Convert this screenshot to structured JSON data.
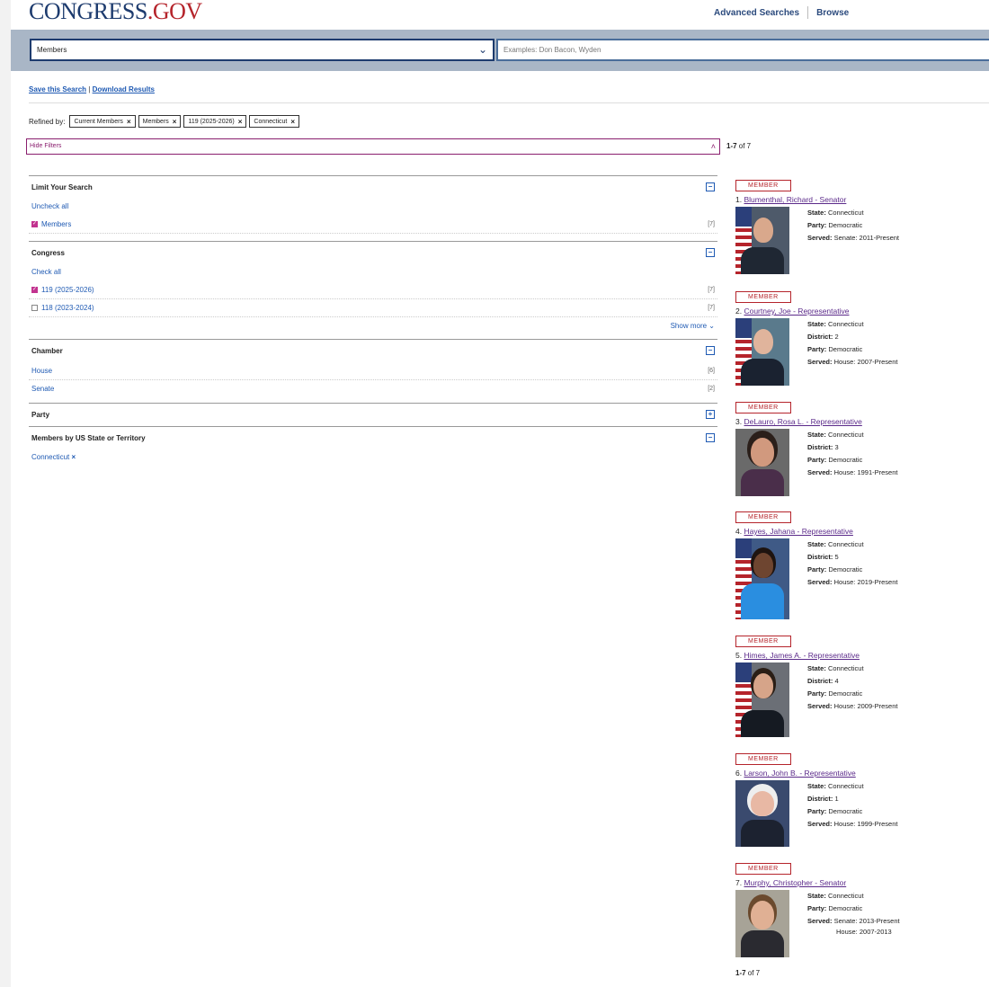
{
  "header": {
    "logo_part1": "CONGRESS",
    "logo_part2": ".GOV",
    "nav": [
      "Advanced Searches",
      "Browse"
    ]
  },
  "search": {
    "scope": "Members",
    "placeholder": "Examples: Don Bacon, Wyden"
  },
  "actions": {
    "save": "Save this Search",
    "divider": "|",
    "download": "Download Results"
  },
  "refined": {
    "label": "Refined by:",
    "pills": [
      "Current Members",
      "Members",
      "119 (2025-2026)",
      "Connecticut"
    ]
  },
  "filters_bar": {
    "label": "Hide Filters",
    "count_bold": "1-7",
    "count_rest": " of 7"
  },
  "filters": {
    "limit": {
      "title": "Limit Your Search",
      "link": "Uncheck all",
      "items": [
        {
          "label": "Members",
          "count": "[7]",
          "checked": true
        }
      ]
    },
    "congress": {
      "title": "Congress",
      "link": "Check all",
      "items": [
        {
          "label": "119 (2025-2026)",
          "count": "[7]",
          "checked": true
        },
        {
          "label": "118 (2023-2024)",
          "count": "[7]",
          "checked": false
        }
      ],
      "show_more": "Show more"
    },
    "chamber": {
      "title": "Chamber",
      "items": [
        {
          "label": "House",
          "count": "[6]"
        },
        {
          "label": "Senate",
          "count": "[2]"
        }
      ]
    },
    "party": {
      "title": "Party"
    },
    "state": {
      "title": "Members by US State or Territory",
      "value": "Connecticut"
    }
  },
  "results": {
    "badge": "MEMBER",
    "labels": {
      "state": "State:",
      "district": "District:",
      "party": "Party:",
      "served": "Served:"
    },
    "items": [
      {
        "num": "1.",
        "name": "Blumenthal, Richard - Senator",
        "state": "Connecticut",
        "district": "",
        "party": "Democratic",
        "served": "Senate: 2011-Present",
        "served2": ""
      },
      {
        "num": "2.",
        "name": "Courtney, Joe - Representative",
        "state": "Connecticut",
        "district": "2",
        "party": "Democratic",
        "served": "House: 2007-Present",
        "served2": ""
      },
      {
        "num": "3.",
        "name": "DeLauro, Rosa L. - Representative",
        "state": "Connecticut",
        "district": "3",
        "party": "Democratic",
        "served": "House: 1991-Present",
        "served2": ""
      },
      {
        "num": "4.",
        "name": "Hayes, Jahana - Representative",
        "state": "Connecticut",
        "district": "5",
        "party": "Democratic",
        "served": "House: 2019-Present",
        "served2": ""
      },
      {
        "num": "5.",
        "name": "Himes, James A. - Representative",
        "state": "Connecticut",
        "district": "4",
        "party": "Democratic",
        "served": "House: 2009-Present",
        "served2": ""
      },
      {
        "num": "6.",
        "name": "Larson, John B. - Representative",
        "state": "Connecticut",
        "district": "1",
        "party": "Democratic",
        "served": "House: 1999-Present",
        "served2": ""
      },
      {
        "num": "7.",
        "name": "Murphy, Christopher - Senator",
        "state": "Connecticut",
        "district": "",
        "party": "Democratic",
        "served": "Senate: 2013-Present",
        "served2": "House: 2007-2013"
      }
    ]
  },
  "footer_count": {
    "bold": "1-7",
    "rest": " of 7"
  },
  "colors": {
    "brand_blue": "#1d3b6e",
    "brand_red": "#b5242b",
    "accent_purple": "#8a1e6e",
    "link_blue": "#1f5ab3"
  }
}
